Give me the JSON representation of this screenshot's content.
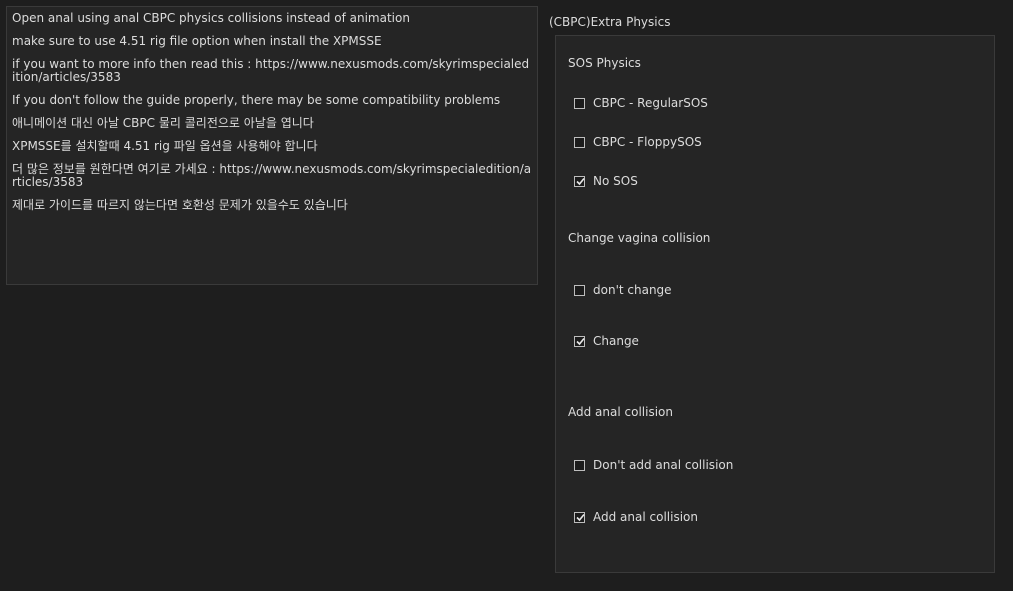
{
  "description": {
    "paragraphs": [
      "Open anal using anal CBPC physics collisions instead of animation",
      "make sure to use 4.51 rig file option when install the XPMSSE",
      "if you want to more info then read this : https://www.nexusmods.com/skyrimspecialedition/articles/3583",
      "If you don't follow the guide properly, there may be some compatibility problems",
      "애니메이션 대신 아날 CBPC 물리 콜리전으로 아날을 엽니다",
      "XPMSSE를 설치할때 4.51 rig 파일 옵션을 사용해야 합니다",
      "더 많은 정보를 원한다면 여기로 가세요 : https://www.nexusmods.com/skyrimspecialedition/articles/3583",
      "제대로 가이드를 따르지 않는다면 호환성 문제가 있을수도 있습니다"
    ]
  },
  "group": {
    "title": "(CBPC)Extra Physics"
  },
  "sections": [
    {
      "label": "SOS Physics",
      "options": [
        {
          "label": "CBPC - RegularSOS",
          "checked": false
        },
        {
          "label": "CBPC - FloppySOS",
          "checked": false
        },
        {
          "label": "No SOS",
          "checked": true
        }
      ]
    },
    {
      "label": "Change vagina collision",
      "options": [
        {
          "label": "don't change",
          "checked": false
        },
        {
          "label": "Change",
          "checked": true
        }
      ]
    },
    {
      "label": "Add anal collision",
      "options": [
        {
          "label": "Don't add anal collision",
          "checked": false
        },
        {
          "label": "Add anal collision",
          "checked": true
        }
      ]
    }
  ]
}
